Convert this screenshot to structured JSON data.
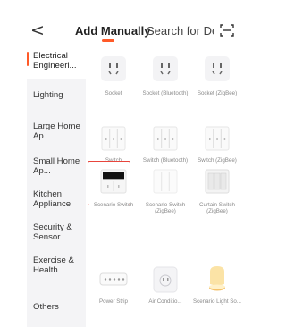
{
  "header": {
    "back_label": "<",
    "tab_active": "Add Manually",
    "tab_other": "Search for Devi",
    "accent_color": "#ff5a28"
  },
  "icons": {
    "back": "chevron-left-icon",
    "scan": "scan-frame-icon"
  },
  "sidebar": {
    "items": [
      {
        "label": "Electrical Engineeri...",
        "active": true
      },
      {
        "label": "Lighting"
      },
      {
        "label": "Large Home Ap..."
      },
      {
        "label": "Small Home Ap..."
      },
      {
        "label": "Kitchen Appliance"
      },
      {
        "label": "Security & Sensor"
      },
      {
        "label": "Exercise & Health"
      },
      {
        "label": "Others"
      }
    ]
  },
  "grid": {
    "items": [
      {
        "label": "",
        "icon": "socket-plug-icon"
      },
      {
        "label": "",
        "icon": "socket-plug-icon"
      },
      {
        "label": "",
        "icon": "socket-plug-icon"
      },
      {
        "label": "Socket",
        "icon": ""
      },
      {
        "label": "Socket (Bluetooth)",
        "icon": ""
      },
      {
        "label": "Socket (ZigBee)",
        "icon": ""
      },
      {
        "label": "Switch",
        "icon": "wall-switch-icon"
      },
      {
        "label": "Switch (Bluetooth)",
        "icon": "wall-switch-icon"
      },
      {
        "label": "Switch (ZigBee)",
        "icon": "wall-switch-icon"
      },
      {
        "label": "Scenario Switch",
        "icon": "scenario-switch-icon",
        "selected": true
      },
      {
        "label": "Scenario Switch (ZigBee)",
        "icon": "scenario-switch-icon"
      },
      {
        "label": "Curtain Switch (ZigBee)",
        "icon": "curtain-switch-icon"
      },
      {
        "label": "Power Strip",
        "icon": "power-strip-icon"
      },
      {
        "label": "Air Conditio...",
        "icon": "air-conditioner-plug-icon"
      },
      {
        "label": "Scenario Light So...",
        "icon": "light-socket-icon"
      }
    ]
  }
}
